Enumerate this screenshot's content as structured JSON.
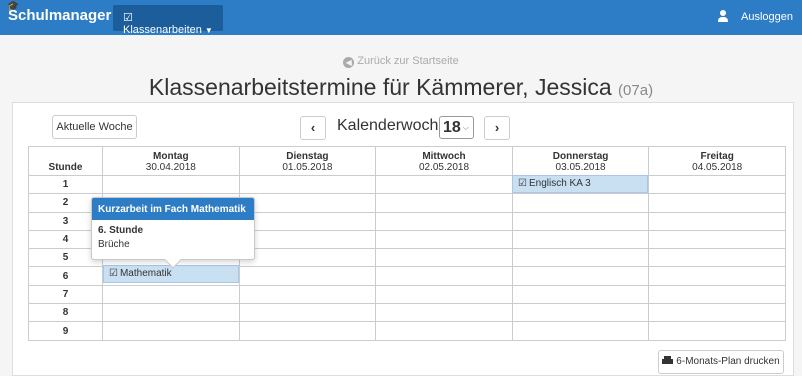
{
  "navbar": {
    "brand": "Schulmanager",
    "menu_label": "Klassenarbeiten",
    "logout_label": "Ausloggen",
    "accent_color": "#2d7cc6"
  },
  "back_link": "Zurück zur Startseite",
  "page": {
    "title": "Klassenarbeitstermine für Kämmerer, Jessica",
    "klasse": "(07a)"
  },
  "week_nav": {
    "current_week_label": "Aktuelle Woche",
    "kw_label": "Kalenderwoche",
    "kw_value": "18",
    "prev_icon": "chevron-left-icon",
    "next_icon": "chevron-right-icon"
  },
  "table": {
    "stunde_header": "Stunde",
    "days": [
      {
        "name": "Montag",
        "date": "30.04.2018"
      },
      {
        "name": "Dienstag",
        "date": "01.05.2018"
      },
      {
        "name": "Mittwoch",
        "date": "02.05.2018"
      },
      {
        "name": "Donnerstag",
        "date": "03.05.2018"
      },
      {
        "name": "Freitag",
        "date": "04.05.2018"
      }
    ],
    "periods": [
      "1",
      "2",
      "3",
      "4",
      "5",
      "6",
      "7",
      "8",
      "9"
    ]
  },
  "events": {
    "englisch": "Englisch KA 3",
    "mathe": "Mathematik"
  },
  "popover": {
    "title": "Kurzarbeit im Fach Mathematik",
    "stunde": "6. Stunde",
    "topic": "Brüche"
  },
  "print_button": "6-Monats-Plan drucken"
}
